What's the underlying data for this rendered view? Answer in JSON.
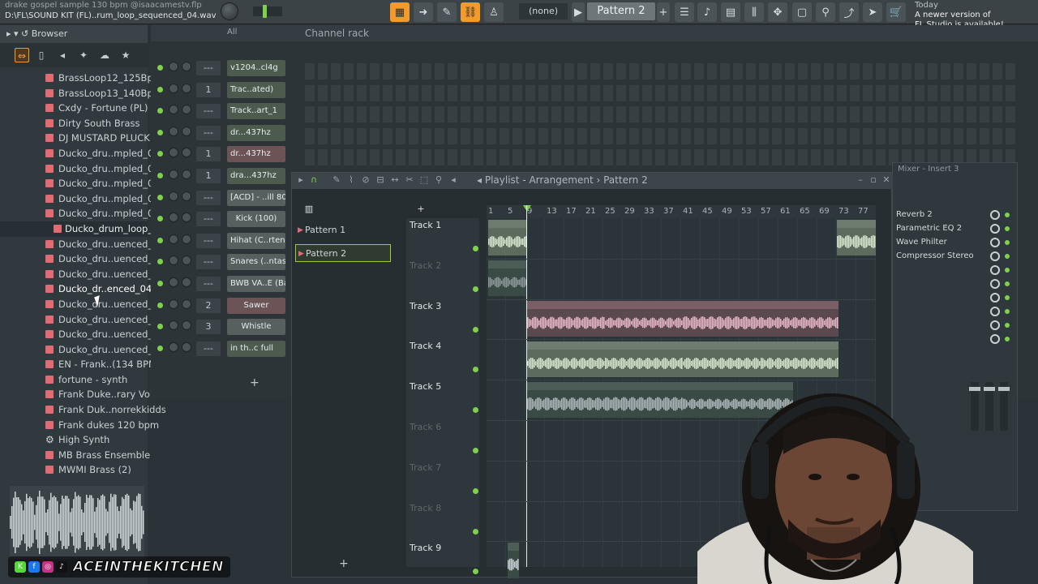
{
  "window": {
    "title_line1": "drake gospel sample 130 bpm @isaacamestv.flp",
    "title_line2": "D:\\FL\\SOUND KIT (FL)..rum_loop_sequenced_04.wav",
    "none_label": "(none)",
    "pattern_selector": "Pattern 2",
    "news_line1": "Today",
    "news_line2": "A newer version of",
    "news_line3": "FL Studio is available!"
  },
  "browser": {
    "title": "Browser",
    "items": [
      {
        "label": "BrassLoop12_125Bpm",
        "icon": "audio-file-icon"
      },
      {
        "label": "BrassLoop13_140Bpm",
        "icon": "audio-file-icon"
      },
      {
        "label": "Cxdy - Fortune (PL)",
        "icon": "audio-file-icon"
      },
      {
        "label": "Dirty South Brass",
        "icon": "audio-file-icon"
      },
      {
        "label": "DJ MUSTARD PLUCK",
        "icon": "audio-file-icon"
      },
      {
        "label": "Ducko_dru..mpled_01",
        "icon": "audio-file-icon"
      },
      {
        "label": "Ducko_dru..mpled_02",
        "icon": "audio-file-icon"
      },
      {
        "label": "Ducko_dru..mpled_03",
        "icon": "audio-file-icon"
      },
      {
        "label": "Ducko_dru..mpled_04",
        "icon": "audio-file-icon"
      },
      {
        "label": "Ducko_dru..mpled_05",
        "icon": "audio-file-icon"
      },
      {
        "label": "Ducko_drum_loop_sampled_06",
        "icon": "audio-file-icon",
        "hover": true
      },
      {
        "label": "Ducko_dru..uenced_01",
        "icon": "audio-file-icon"
      },
      {
        "label": "Ducko_dru..uenced_02",
        "icon": "audio-file-icon"
      },
      {
        "label": "Ducko_dru..uenced_03",
        "icon": "audio-file-icon"
      },
      {
        "label": "Ducko_dr..enced_04",
        "icon": "audio-file-icon",
        "selected": true
      },
      {
        "label": "Ducko_dru..uenced_05",
        "icon": "audio-file-icon"
      },
      {
        "label": "Ducko_dru..uenced_06",
        "icon": "audio-file-icon"
      },
      {
        "label": "Ducko_dru..uenced_07",
        "icon": "audio-file-icon"
      },
      {
        "label": "Ducko_dru..uenced_08",
        "icon": "audio-file-icon"
      },
      {
        "label": "EN - Frank..(134 BPM)",
        "icon": "audio-file-icon"
      },
      {
        "label": "fortune - synth",
        "icon": "audio-file-icon"
      },
      {
        "label": "Frank Duke..rary Vol. 6",
        "icon": "audio-file-icon"
      },
      {
        "label": "Frank Duk..norrekkidds",
        "icon": "audio-file-icon"
      },
      {
        "label": "Frank dukes 120 bpm",
        "icon": "audio-file-icon"
      },
      {
        "label": "High Synth",
        "icon": "synth-gear-icon"
      },
      {
        "label": "MB Brass Ensemble",
        "icon": "audio-file-icon"
      },
      {
        "label": "MWMI Brass (2)",
        "icon": "audio-file-icon"
      }
    ]
  },
  "channel_rack": {
    "title": "Channel rack",
    "filter": "All",
    "channels": [
      {
        "num": "---",
        "name": "v1204..cl4g",
        "style": "green"
      },
      {
        "num": "1",
        "name": "Trac..ated)",
        "style": "green"
      },
      {
        "num": "---",
        "name": "Track..art_1",
        "style": "green"
      },
      {
        "num": "---",
        "name": "dr...437hz",
        "style": "green"
      },
      {
        "num": "1",
        "name": "dr...437hz",
        "style": "pinkish"
      },
      {
        "num": "1",
        "name": "dra...437hz",
        "style": "green"
      },
      {
        "num": "---",
        "name": "[ACD] - ..ill 808",
        "style": ""
      },
      {
        "num": "---",
        "name": "Kick (100)",
        "style": "center"
      },
      {
        "num": "---",
        "name": "Hihat (C..rtened",
        "style": ""
      },
      {
        "num": "---",
        "name": "Snares (..ntasy)",
        "style": ""
      },
      {
        "num": "---",
        "name": "BWB VA..E (Bab)",
        "style": ""
      },
      {
        "num": "2",
        "name": "Sawer",
        "style": "pinkish-center"
      },
      {
        "num": "3",
        "name": "Whistle",
        "style": "center"
      },
      {
        "num": "---",
        "name": "in th..c full",
        "style": "green"
      }
    ]
  },
  "playlist": {
    "title": "Playlist - Arrangement",
    "breadcrumb_pattern": "Pattern 2",
    "patterns": [
      "Pattern 1",
      "Pattern 2"
    ],
    "selected_pattern": "Pattern 2",
    "ruler": [
      "1",
      "5",
      "9",
      "13",
      "17",
      "21",
      "25",
      "29",
      "33",
      "37",
      "41",
      "45",
      "49",
      "53",
      "57",
      "61",
      "65",
      "69",
      "73",
      "77"
    ],
    "tracks": [
      "Track 1",
      "Track 2",
      "Track 3",
      "Track 4",
      "Track 5",
      "Track 6",
      "Track 7",
      "Track 8",
      "Track 9"
    ],
    "clips": {
      "track1_end": "Tra..ted)",
      "track2": "d..437hz",
      "track3": [
        "drake..5bpm-437hz",
        "drake..5bpm-437hz",
        "drake..5bpm-437hz",
        "drak..bpm-437hz"
      ],
      "track4": [
        "drake g..bpm-437hz",
        "drake g..bpm-437hz",
        "drake g..bpm-437hz",
        "drake g..bpm-437hz"
      ],
      "track5": [
        "Pattern 1",
        "Pattern 1",
        "Pattern 1",
        "Pa"
      ]
    }
  },
  "mixer": {
    "title": "Mixer - Insert 3",
    "slots": [
      "Reverb 2",
      "Parametric EQ 2",
      "Wave Philter",
      "Compressor Stereo"
    ]
  },
  "overlay": {
    "watermark": "ACEINTHEKITCHEN"
  },
  "colors": {
    "accent_orange": "#f39a2c",
    "led_green": "#7fd04c",
    "clip_green": "#5d6b5e",
    "clip_pink": "#5a4a50"
  }
}
